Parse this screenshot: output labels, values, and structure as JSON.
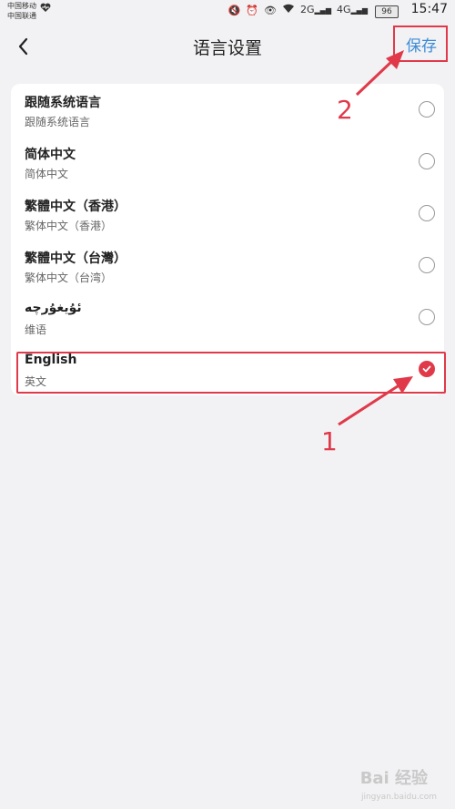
{
  "status_bar": {
    "carrier_1": "中国移动",
    "carrier_2": "中国联通",
    "battery": "96",
    "time": "15:47",
    "net_1": "2G",
    "net_2": "4G"
  },
  "header": {
    "title": "语言设置",
    "save_label": "保存",
    "back_icon": "chevron-left-icon"
  },
  "languages": [
    {
      "name": "跟随系统语言",
      "sub": "跟随系统语言",
      "selected": false
    },
    {
      "name": "简体中文",
      "sub": "简体中文",
      "selected": false
    },
    {
      "name": "繁體中文（香港）",
      "sub": "繁体中文（香港）",
      "selected": false
    },
    {
      "name": "繁體中文（台灣）",
      "sub": "繁体中文（台湾）",
      "selected": false
    },
    {
      "name": "ئۇيغۇرچە",
      "sub": "维语",
      "selected": false
    },
    {
      "name": "English",
      "sub": "英文",
      "selected": true
    }
  ],
  "annotations": {
    "step_1": "1",
    "step_2": "2",
    "color": "#e03a4a"
  },
  "watermark": {
    "text": "Bai 经验",
    "sub": "jingyan.baidu.com"
  },
  "colors": {
    "accent": "#3b8bd8",
    "selected": "#e03a4a",
    "background": "#f2f2f4"
  }
}
